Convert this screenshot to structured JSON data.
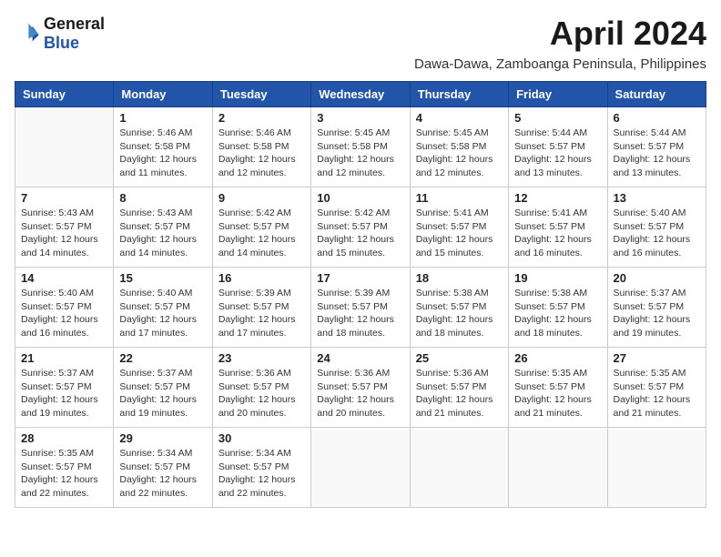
{
  "logo": {
    "general": "General",
    "blue": "Blue"
  },
  "title": "April 2024",
  "subtitle": "Dawa-Dawa, Zamboanga Peninsula, Philippines",
  "days_of_week": [
    "Sunday",
    "Monday",
    "Tuesday",
    "Wednesday",
    "Thursday",
    "Friday",
    "Saturday"
  ],
  "weeks": [
    [
      {
        "day": "",
        "info": ""
      },
      {
        "day": "1",
        "info": "Sunrise: 5:46 AM\nSunset: 5:58 PM\nDaylight: 12 hours\nand 11 minutes."
      },
      {
        "day": "2",
        "info": "Sunrise: 5:46 AM\nSunset: 5:58 PM\nDaylight: 12 hours\nand 12 minutes."
      },
      {
        "day": "3",
        "info": "Sunrise: 5:45 AM\nSunset: 5:58 PM\nDaylight: 12 hours\nand 12 minutes."
      },
      {
        "day": "4",
        "info": "Sunrise: 5:45 AM\nSunset: 5:58 PM\nDaylight: 12 hours\nand 12 minutes."
      },
      {
        "day": "5",
        "info": "Sunrise: 5:44 AM\nSunset: 5:57 PM\nDaylight: 12 hours\nand 13 minutes."
      },
      {
        "day": "6",
        "info": "Sunrise: 5:44 AM\nSunset: 5:57 PM\nDaylight: 12 hours\nand 13 minutes."
      }
    ],
    [
      {
        "day": "7",
        "info": "Sunrise: 5:43 AM\nSunset: 5:57 PM\nDaylight: 12 hours\nand 14 minutes."
      },
      {
        "day": "8",
        "info": "Sunrise: 5:43 AM\nSunset: 5:57 PM\nDaylight: 12 hours\nand 14 minutes."
      },
      {
        "day": "9",
        "info": "Sunrise: 5:42 AM\nSunset: 5:57 PM\nDaylight: 12 hours\nand 14 minutes."
      },
      {
        "day": "10",
        "info": "Sunrise: 5:42 AM\nSunset: 5:57 PM\nDaylight: 12 hours\nand 15 minutes."
      },
      {
        "day": "11",
        "info": "Sunrise: 5:41 AM\nSunset: 5:57 PM\nDaylight: 12 hours\nand 15 minutes."
      },
      {
        "day": "12",
        "info": "Sunrise: 5:41 AM\nSunset: 5:57 PM\nDaylight: 12 hours\nand 16 minutes."
      },
      {
        "day": "13",
        "info": "Sunrise: 5:40 AM\nSunset: 5:57 PM\nDaylight: 12 hours\nand 16 minutes."
      }
    ],
    [
      {
        "day": "14",
        "info": "Sunrise: 5:40 AM\nSunset: 5:57 PM\nDaylight: 12 hours\nand 16 minutes."
      },
      {
        "day": "15",
        "info": "Sunrise: 5:40 AM\nSunset: 5:57 PM\nDaylight: 12 hours\nand 17 minutes."
      },
      {
        "day": "16",
        "info": "Sunrise: 5:39 AM\nSunset: 5:57 PM\nDaylight: 12 hours\nand 17 minutes."
      },
      {
        "day": "17",
        "info": "Sunrise: 5:39 AM\nSunset: 5:57 PM\nDaylight: 12 hours\nand 18 minutes."
      },
      {
        "day": "18",
        "info": "Sunrise: 5:38 AM\nSunset: 5:57 PM\nDaylight: 12 hours\nand 18 minutes."
      },
      {
        "day": "19",
        "info": "Sunrise: 5:38 AM\nSunset: 5:57 PM\nDaylight: 12 hours\nand 18 minutes."
      },
      {
        "day": "20",
        "info": "Sunrise: 5:37 AM\nSunset: 5:57 PM\nDaylight: 12 hours\nand 19 minutes."
      }
    ],
    [
      {
        "day": "21",
        "info": "Sunrise: 5:37 AM\nSunset: 5:57 PM\nDaylight: 12 hours\nand 19 minutes."
      },
      {
        "day": "22",
        "info": "Sunrise: 5:37 AM\nSunset: 5:57 PM\nDaylight: 12 hours\nand 19 minutes."
      },
      {
        "day": "23",
        "info": "Sunrise: 5:36 AM\nSunset: 5:57 PM\nDaylight: 12 hours\nand 20 minutes."
      },
      {
        "day": "24",
        "info": "Sunrise: 5:36 AM\nSunset: 5:57 PM\nDaylight: 12 hours\nand 20 minutes."
      },
      {
        "day": "25",
        "info": "Sunrise: 5:36 AM\nSunset: 5:57 PM\nDaylight: 12 hours\nand 21 minutes."
      },
      {
        "day": "26",
        "info": "Sunrise: 5:35 AM\nSunset: 5:57 PM\nDaylight: 12 hours\nand 21 minutes."
      },
      {
        "day": "27",
        "info": "Sunrise: 5:35 AM\nSunset: 5:57 PM\nDaylight: 12 hours\nand 21 minutes."
      }
    ],
    [
      {
        "day": "28",
        "info": "Sunrise: 5:35 AM\nSunset: 5:57 PM\nDaylight: 12 hours\nand 22 minutes."
      },
      {
        "day": "29",
        "info": "Sunrise: 5:34 AM\nSunset: 5:57 PM\nDaylight: 12 hours\nand 22 minutes."
      },
      {
        "day": "30",
        "info": "Sunrise: 5:34 AM\nSunset: 5:57 PM\nDaylight: 12 hours\nand 22 minutes."
      },
      {
        "day": "",
        "info": ""
      },
      {
        "day": "",
        "info": ""
      },
      {
        "day": "",
        "info": ""
      },
      {
        "day": "",
        "info": ""
      }
    ]
  ]
}
